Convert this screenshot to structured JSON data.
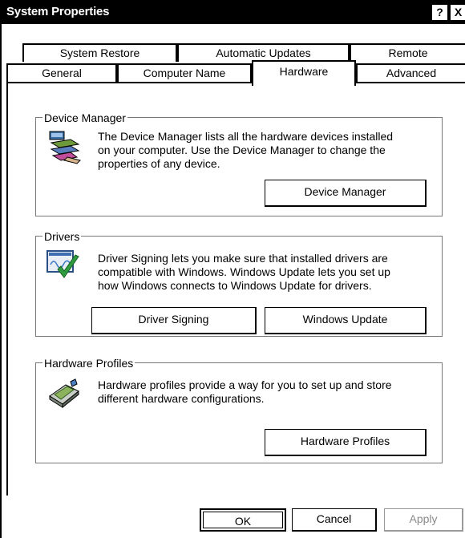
{
  "window": {
    "title": "System Properties",
    "help_label": "?",
    "close_label": "X"
  },
  "tabs": {
    "row1": [
      "System Restore",
      "Automatic Updates",
      "Remote"
    ],
    "row2": [
      "General",
      "Computer Name",
      "Hardware",
      "Advanced"
    ],
    "selected": "Hardware"
  },
  "device_manager": {
    "group_title": "Device Manager",
    "description": [
      "The Device Manager lists all the hardware devices installed",
      "on your computer. Use the Device Manager to change the",
      "properties of any device."
    ],
    "button_label": "Device Manager",
    "icon": "device-manager-icon"
  },
  "drivers": {
    "group_title": "Drivers",
    "description": [
      "Driver Signing lets you make sure that installed drivers are",
      "compatible with Windows. Windows Update lets you set up",
      "how Windows connects to Windows Update for drivers."
    ],
    "driver_signing_label": "Driver Signing",
    "windows_update_label": "Windows Update",
    "icon": "driver-signing-icon"
  },
  "hardware_profiles": {
    "group_title": "Hardware Profiles",
    "description": [
      "Hardware profiles provide a way for you to set up and store",
      "different hardware configurations."
    ],
    "button_label": "Hardware Profiles",
    "icon": "hardware-profiles-icon"
  },
  "footer": {
    "ok_label": "OK",
    "cancel_label": "Cancel",
    "apply_label": "Apply"
  }
}
